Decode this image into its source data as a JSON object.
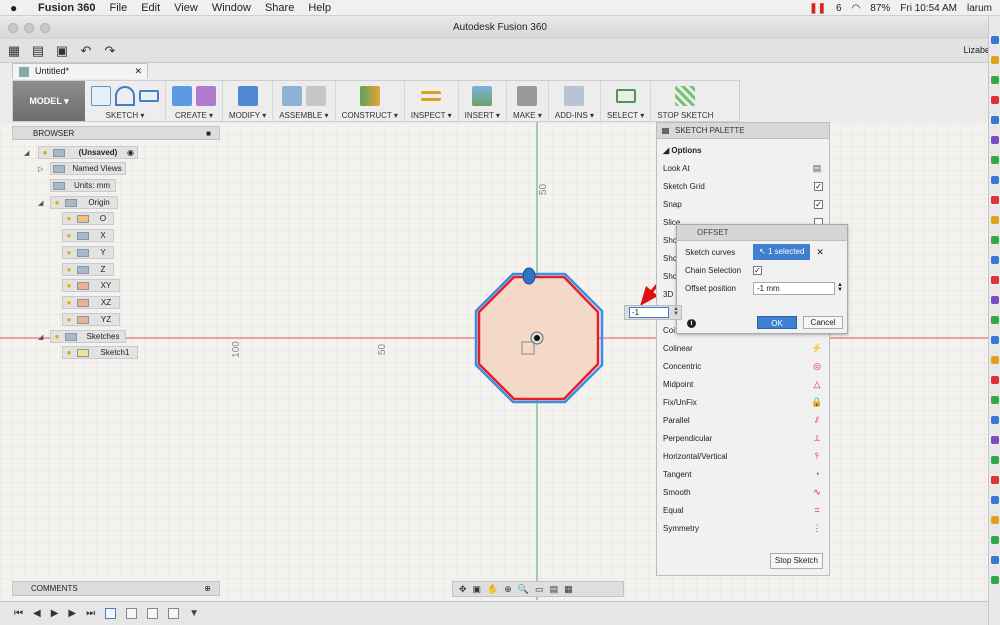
{
  "menubar": {
    "apple": "",
    "app": "Fusion 360",
    "items": [
      "File",
      "Edit",
      "View",
      "Window",
      "Share",
      "Help"
    ],
    "status_count": "6",
    "battery": "87%",
    "clock": "Fri 10:54 AM",
    "user": "larum"
  },
  "window": {
    "title": "Autodesk Fusion 360",
    "user_name": "Lizabe"
  },
  "document_tab": {
    "label": "Untitled*",
    "close": "✕"
  },
  "toolbar": {
    "workspace": "MODEL ▾",
    "groups": [
      {
        "label": "SKETCH ▾"
      },
      {
        "label": "CREATE ▾"
      },
      {
        "label": "MODIFY ▾"
      },
      {
        "label": "ASSEMBLE ▾"
      },
      {
        "label": "CONSTRUCT ▾"
      },
      {
        "label": "INSPECT ▾"
      },
      {
        "label": "INSERT ▾"
      },
      {
        "label": "MAKE ▾"
      },
      {
        "label": "ADD-INS ▾"
      },
      {
        "label": "SELECT ▾"
      },
      {
        "label": "STOP SKETCH"
      }
    ]
  },
  "browser": {
    "title": "BROWSER",
    "root": "(Unsaved)",
    "named_views": "Named Views",
    "units": "Units: mm",
    "origin": "Origin",
    "origin_items": [
      "O",
      "X",
      "Y",
      "Z",
      "XY",
      "XZ",
      "YZ"
    ],
    "sketches": "Sketches",
    "sketch1": "Sketch1"
  },
  "canvas": {
    "ruler_top": "50",
    "ruler_left_100": "100",
    "ruler_left_50": "50"
  },
  "sketch_palette": {
    "title": "SKETCH PALETTE",
    "options_label": "Options",
    "options": [
      {
        "label": "Look At",
        "checked": null
      },
      {
        "label": "Sketch Grid",
        "checked": true
      },
      {
        "label": "Snap",
        "checked": true
      },
      {
        "label": "Slice",
        "checked": false
      },
      {
        "label": "Sho"
      },
      {
        "label": "Sho"
      },
      {
        "label": "Sho"
      },
      {
        "label": "3D"
      }
    ],
    "constraints": [
      {
        "label": "Coi"
      },
      {
        "label": "Colinear",
        "icon": "⚡"
      },
      {
        "label": "Concentric",
        "icon": "◎"
      },
      {
        "label": "Midpoint",
        "icon": "△"
      },
      {
        "label": "Fix/UnFix",
        "icon": "🔒"
      },
      {
        "label": "Parallel",
        "icon": "⫽"
      },
      {
        "label": "Perpendicular",
        "icon": "⟂"
      },
      {
        "label": "Horizontal/Vertical",
        "icon": "⫯"
      },
      {
        "label": "Tangent",
        "icon": "◔"
      },
      {
        "label": "Smooth",
        "icon": "∿"
      },
      {
        "label": "Equal",
        "icon": "="
      },
      {
        "label": "Symmetry",
        "icon": "⋮"
      }
    ],
    "stop_sketch": "Stop Sketch"
  },
  "offset_dialog": {
    "title": "OFFSET",
    "sketch_curves_label": "Sketch curves",
    "selected_text": "1 selected",
    "clear": "✕",
    "chain_selection_label": "Chain Selection",
    "chain_checked": "✓",
    "offset_position_label": "Offset position",
    "offset_value": "-1 mm",
    "info": "i",
    "ok": "OK",
    "cancel": "Cancel"
  },
  "live_input": {
    "value": "-1"
  },
  "comments": {
    "title": "COMMENTS"
  },
  "colors": {
    "accent": "#3e7fcf",
    "sketch_red": "#e0202a",
    "offset_blue": "#3a8ee6",
    "axis_green": "#3bb36a",
    "axis_red": "#e05050",
    "fill": "#f4d9c8"
  }
}
